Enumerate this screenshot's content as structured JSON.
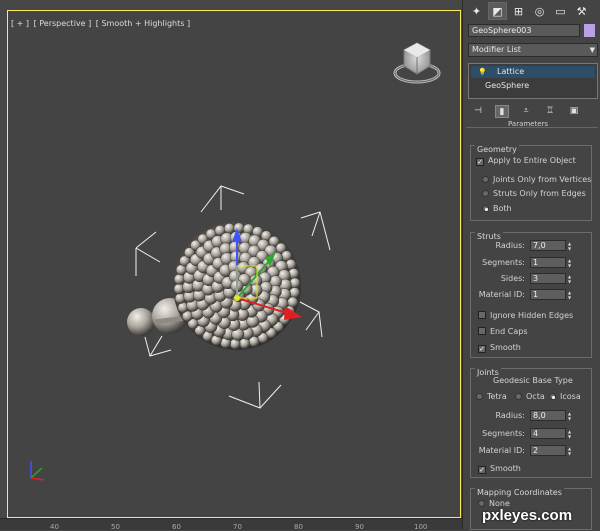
{
  "viewport": {
    "label_parts": [
      "[ + ]",
      "[ Perspective ]",
      "[ Smooth + Highlights ]"
    ]
  },
  "timeline": {
    "ticks": [
      "40",
      "50",
      "60",
      "70",
      "80",
      "90",
      "100"
    ]
  },
  "watermark": "pxleyes.com",
  "panel": {
    "tabs": [
      "create-icon",
      "modify-icon",
      "hierarchy-icon",
      "motion-icon",
      "display-icon",
      "utilities-icon"
    ],
    "object_name": "GeoSphere003",
    "object_color": "#b7a1e4",
    "modifier_list": "Modifier List",
    "stack": [
      "Lattice",
      "GeoSphere"
    ],
    "rollout_title": "Parameters",
    "geometry": {
      "title": "Geometry",
      "apply_entire": "Apply to Entire Object",
      "apply_entire_checked": true,
      "options": [
        "Joints Only from Vertices",
        "Struts Only from Edges",
        "Both"
      ],
      "selected": "Both"
    },
    "struts": {
      "title": "Struts",
      "fields": [
        {
          "label": "Radius:",
          "value": "7,0"
        },
        {
          "label": "Segments:",
          "value": "1"
        },
        {
          "label": "Sides:",
          "value": "3"
        },
        {
          "label": "Material ID:",
          "value": "1"
        }
      ],
      "checks": [
        {
          "label": "Ignore Hidden Edges",
          "checked": false
        },
        {
          "label": "End Caps",
          "checked": false
        },
        {
          "label": "Smooth",
          "checked": true
        }
      ]
    },
    "joints": {
      "title": "Joints",
      "base_type_label": "Geodesic Base Type",
      "base_types": [
        "Tetra",
        "Octa",
        "Icosa"
      ],
      "base_selected": "Icosa",
      "fields": [
        {
          "label": "Radius:",
          "value": "8,0"
        },
        {
          "label": "Segments:",
          "value": "4"
        },
        {
          "label": "Material ID:",
          "value": "2"
        }
      ],
      "smooth": "Smooth",
      "smooth_checked": true
    },
    "mapping": {
      "title": "Mapping Coordinates",
      "options": [
        "None"
      ]
    }
  }
}
